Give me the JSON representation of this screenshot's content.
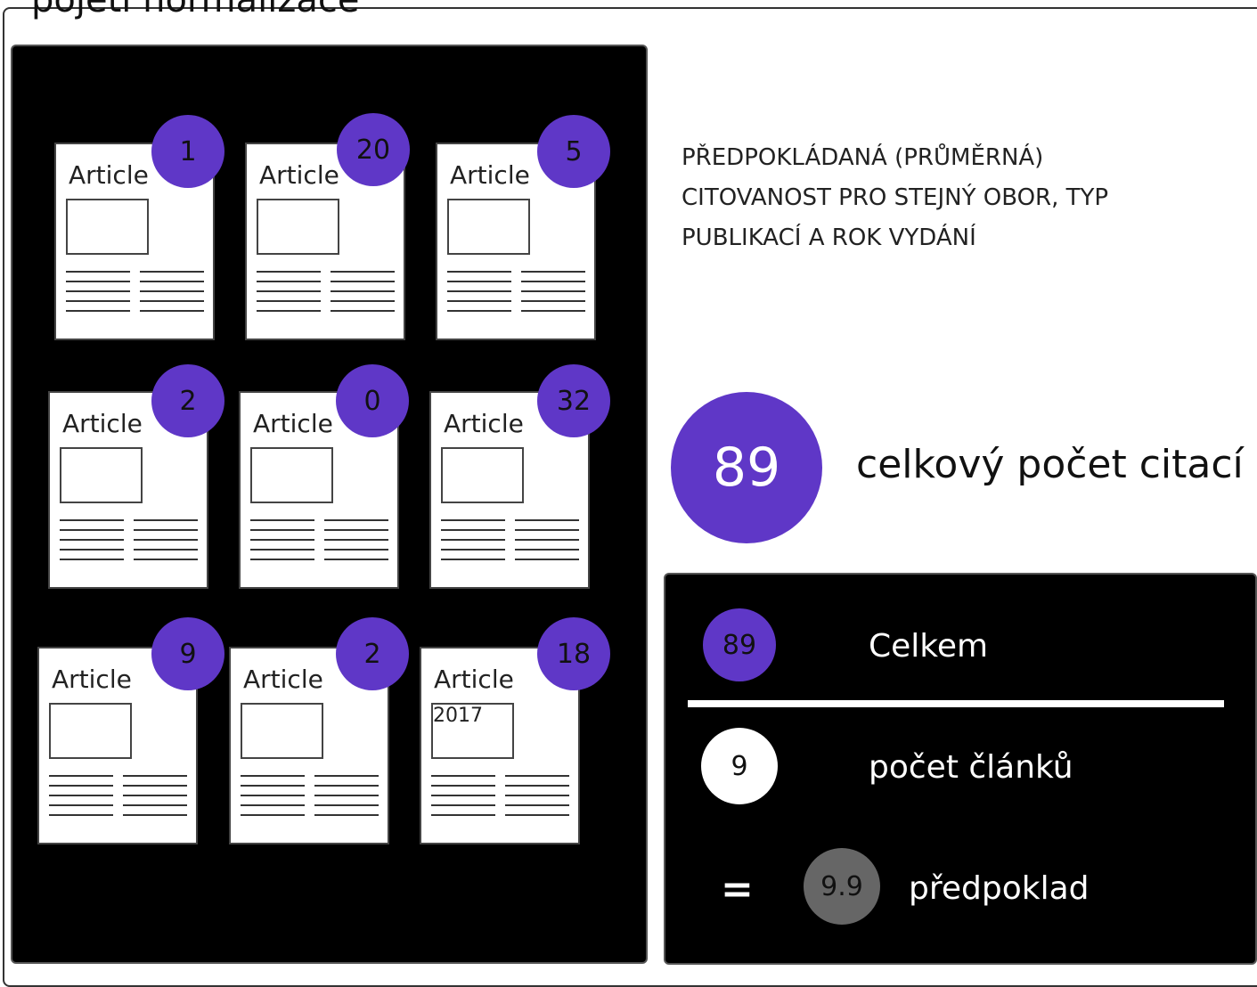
{
  "title": "pojetí normalizace",
  "articles": [
    {
      "label": "Article",
      "count": "1",
      "box_text": ""
    },
    {
      "label": "Article",
      "count": "20",
      "box_text": ""
    },
    {
      "label": "Article",
      "count": "5",
      "box_text": ""
    },
    {
      "label": "Article",
      "count": "2",
      "box_text": ""
    },
    {
      "label": "Article",
      "count": "0",
      "box_text": ""
    },
    {
      "label": "Article",
      "count": "32",
      "box_text": ""
    },
    {
      "label": "Article",
      "count": "9",
      "box_text": ""
    },
    {
      "label": "Article",
      "count": "2",
      "box_text": ""
    },
    {
      "label": "Article",
      "count": "18",
      "box_text": "2017"
    }
  ],
  "description": "PŘEDPOKLÁDANÁ (PRŮMĚRNÁ) CITOVANOST PRO STEJNÝ OBOR, TYP PUBLIKACÍ A ROK VYDÁNÍ",
  "total": {
    "value": "89",
    "label": "celkový počet citací"
  },
  "calc": {
    "total_value": "89",
    "total_label": "Celkem",
    "count_value": "9",
    "count_label": "počet článků",
    "equals": "=",
    "result_value": "9.9",
    "result_label": "předpoklad"
  },
  "colors": {
    "accent": "#5f37c7",
    "result": "#666666",
    "panel": "#000000"
  }
}
